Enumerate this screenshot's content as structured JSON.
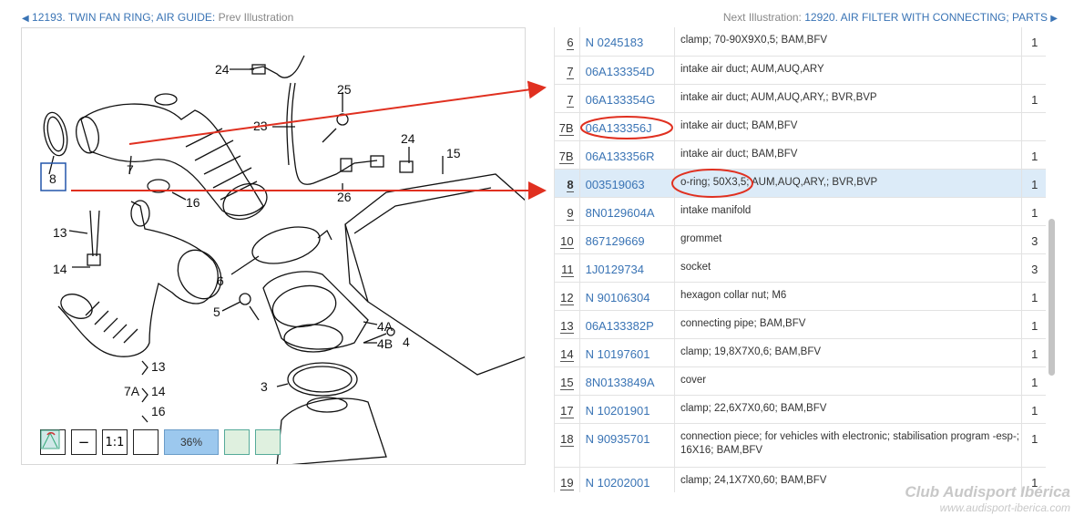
{
  "nav": {
    "prev_id": "12193.",
    "prev_title": "TWIN FAN RING; AIR GUIDE:",
    "prev_label": "Prev Illustration",
    "next_label": "Next Illustration:",
    "next_id": "12920.",
    "next_title": "AIR FILTER WITH CONNECTING; PARTS"
  },
  "toolbar": {
    "plus": "+",
    "minus": "−",
    "one_to_one": "1:1",
    "zoom": "36%"
  },
  "callouts": {
    "c24a": "24",
    "c25": "25",
    "c23": "23",
    "c24b": "24",
    "c15": "15",
    "c26": "26",
    "c8": "8",
    "c7": "7",
    "c16": "16",
    "c13a": "13",
    "c14": "14",
    "c6": "6",
    "c5": "5",
    "c4a": "4A",
    "c4b": "4B",
    "c4": "4",
    "c13b": "13",
    "c7a": "7A",
    "c14b": "14",
    "c16b": "16",
    "c3": "3"
  },
  "parts": [
    {
      "pos": "6",
      "pn": "N 0245183",
      "desc": "clamp; 70-90X9X0,5; BAM,BFV",
      "qty": "1"
    },
    {
      "pos": "7",
      "pn": "06A133354D",
      "desc": "intake air duct; AUM,AUQ,ARY",
      "qty": ""
    },
    {
      "pos": "7",
      "pn": "06A133354G",
      "desc": "intake air duct; AUM,AUQ,ARY,; BVR,BVP",
      "qty": "1"
    },
    {
      "pos": "7B",
      "pn": "06A133356J",
      "desc": "intake air duct; BAM,BFV",
      "qty": ""
    },
    {
      "pos": "7B",
      "pn": "06A133356R",
      "desc": "intake air duct; BAM,BFV",
      "qty": "1"
    },
    {
      "pos": "8",
      "pn": "003519063",
      "desc": "o-ring; 50X3,5; AUM,AUQ,ARY,; BVR,BVP",
      "qty": "1"
    },
    {
      "pos": "9",
      "pn": "8N0129604A",
      "desc": "intake manifold",
      "qty": "1"
    },
    {
      "pos": "10",
      "pn": "867129669",
      "desc": "grommet",
      "qty": "3"
    },
    {
      "pos": "11",
      "pn": "1J0129734",
      "desc": "socket",
      "qty": "3"
    },
    {
      "pos": "12",
      "pn": "N 90106304",
      "desc": "hexagon collar nut; M6",
      "qty": "1"
    },
    {
      "pos": "13",
      "pn": "06A133382P",
      "desc": "connecting pipe; BAM,BFV",
      "qty": "1"
    },
    {
      "pos": "14",
      "pn": "N 10197601",
      "desc": "clamp; 19,8X7X0,6; BAM,BFV",
      "qty": "1"
    },
    {
      "pos": "15",
      "pn": "8N0133849A",
      "desc": "cover",
      "qty": "1"
    },
    {
      "pos": "17",
      "pn": "N 10201901",
      "desc": "clamp; 22,6X7X0,60; BAM,BFV",
      "qty": "1"
    },
    {
      "pos": "18",
      "pn": "N 90935701",
      "desc": "connection piece; for vehicles with electronic; stabilisation program -esp-; 16X16; BAM,BFV",
      "qty": "1"
    },
    {
      "pos": "19",
      "pn": "N 10202001",
      "desc": "clamp; 24,1X7X0,60; BAM,BFV",
      "qty": "1"
    }
  ],
  "watermark": {
    "line1": "Club Audisport Ibérica",
    "line2": "www.audisport-iberica.com"
  },
  "colors": {
    "link": "#3a74b5",
    "highlight_row": "#dcebf8",
    "annotation": "#e03020"
  }
}
